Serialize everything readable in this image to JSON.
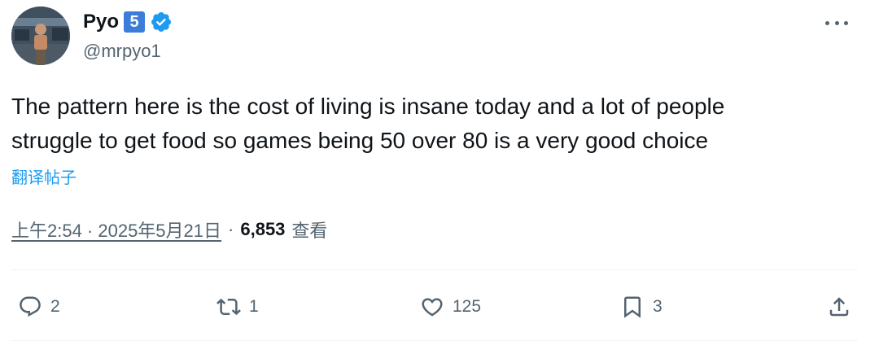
{
  "author": {
    "display_name": "Pyo",
    "badge_number": "5",
    "handle": "@mrpyo1"
  },
  "tweet": {
    "text_line1": "The pattern here is the cost of living is insane today and a lot of people",
    "text_line2": "struggle to get food so games being 50 over 80 is a very good choice",
    "translate_label": "翻译帖子"
  },
  "meta": {
    "timestamp": "上午2:54 · 2025年5月21日",
    "separator": "·",
    "views_count": "6,853",
    "views_label": "查看"
  },
  "actions": {
    "reply_count": "2",
    "repost_count": "1",
    "like_count": "125",
    "bookmark_count": "3"
  },
  "colors": {
    "accent": "#1d9bf0",
    "badge": "#3b7dd8",
    "secondary_text": "#536471",
    "divider": "#eff3f4"
  }
}
